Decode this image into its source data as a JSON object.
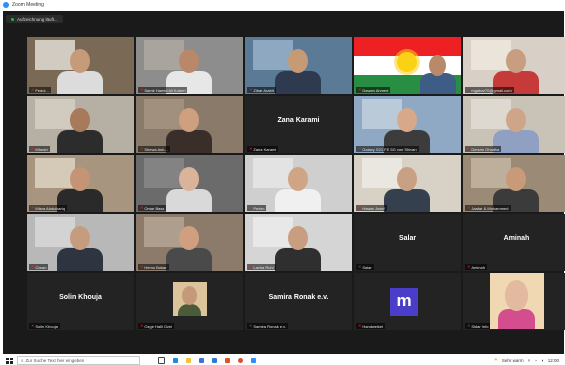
{
  "window": {
    "title": "Zoom Meeting"
  },
  "recording": {
    "label": "Aufzeichnung läuft..."
  },
  "tiles": [
    {
      "label": "Fedoi...",
      "muted": true,
      "kind": "video",
      "bg": "#7a6a55",
      "skin": "#c59b7a",
      "shirt": "#dcdcdc",
      "room": "#e8e4dc"
    },
    {
      "label": "Samir Hamid Ali Koberi",
      "muted": true,
      "kind": "video",
      "bg": "#8d8d8d",
      "skin": "#b9886a",
      "shirt": "#e7e7e7",
      "room": "#b0aba3"
    },
    {
      "label": "Zibar Arabit",
      "muted": true,
      "kind": "video",
      "bg": "#5b7a96",
      "skin": "#c79a76",
      "shirt": "#2d3a4f",
      "room": "#9bb4cc"
    },
    {
      "label": "Dawan Ahmed",
      "muted": true,
      "kind": "flag",
      "skin": "#b98a6a",
      "shirt": "#3d5d86"
    },
    {
      "label": "mgahar70@gmail.com",
      "muted": true,
      "kind": "video",
      "bg": "#d8d0c6",
      "skin": "#c99e80",
      "shirt": "#c63a3a",
      "room": "#efe9e0"
    },
    {
      "label": "Mhedd",
      "muted": true,
      "kind": "video",
      "bg": "#b6b0a4",
      "skin": "#a87a5c",
      "shirt": "#2c2c2c",
      "room": "#d8d2c6"
    },
    {
      "label": "Shewa Ash...",
      "muted": true,
      "kind": "video",
      "bg": "#8a7a6a",
      "skin": "#cfa080",
      "shirt": "#3a2e2a",
      "room": "#a89684"
    },
    {
      "label": "Zana Karami",
      "muted": true,
      "kind": "name",
      "name": "Zana Karami"
    },
    {
      "label": "Galaxy S21 FE 5G von Shivan",
      "muted": true,
      "kind": "video",
      "bg": "#8fa9c4",
      "skin": "#d7a98a",
      "shirt": "#3c3c3c",
      "room": "#c4d2de"
    },
    {
      "label": "Dersim Ghadha",
      "muted": true,
      "kind": "video",
      "speaking": true,
      "bg": "#c9c3b7",
      "skin": "#cfa58a",
      "shirt": "#8fa0c3",
      "room": "#e4dfd6"
    },
    {
      "label": "Misra Abdulkariq",
      "muted": true,
      "kind": "video",
      "bg": "#a89580",
      "skin": "#c49474",
      "shirt": "#2a2a2a",
      "room": "#e0d6c6"
    },
    {
      "label": "Omar Bass",
      "muted": true,
      "kind": "video",
      "bg": "#6b6b6b",
      "skin": "#d9b39a",
      "shirt": "#d9d9d9",
      "room": "#8a8a8a"
    },
    {
      "label": "Pezim",
      "muted": true,
      "kind": "video",
      "bg": "#cfcfcf",
      "skin": "#d0a585",
      "shirt": "#f0f0f0",
      "room": "#e7e7e7"
    },
    {
      "label": "Hawar Josef",
      "muted": true,
      "kind": "video",
      "bg": "#d7d1c6",
      "skin": "#c8a084",
      "shirt": "#35404f",
      "room": "#efece6"
    },
    {
      "label": "Jaafar & Mohammed",
      "muted": true,
      "kind": "video",
      "bg": "#9b8a76",
      "skin": "#c89a78",
      "shirt": "#3b3b3b",
      "room": "#c6b8a6"
    },
    {
      "label": "Ciwan",
      "muted": true,
      "kind": "video",
      "bg": "#b8b8b8",
      "skin": "#c69c7e",
      "shirt": "#2e3540",
      "room": "#d9d9d9"
    },
    {
      "label": "Hemo Bokar",
      "muted": true,
      "kind": "video",
      "bg": "#8c7b6a",
      "skin": "#cf9f7f",
      "shirt": "#4a4a4a",
      "room": "#b7a796"
    },
    {
      "label": "Lacha Ruhi",
      "muted": true,
      "kind": "video",
      "bg": "#d5d5d5",
      "skin": "#c99e80",
      "shirt": "#2f2f2f",
      "room": "#ececec"
    },
    {
      "label": "Salar",
      "muted": true,
      "kind": "name",
      "name": "Salar"
    },
    {
      "label": "Aminah",
      "muted": true,
      "kind": "name",
      "name": "Aminah"
    },
    {
      "label": "Solin Khouja",
      "muted": true,
      "kind": "name",
      "name": "Solin Khouja"
    },
    {
      "label": "Ozge Halil Ozel",
      "muted": true,
      "kind": "photo",
      "bg": "#232323",
      "skin": "#c59a7a",
      "shirt": "#4a5a3a",
      "room": "#dcc49a"
    },
    {
      "label": "Samira Ronak e.v.",
      "muted": true,
      "kind": "name",
      "name": "Samira Ronak e.v."
    },
    {
      "label": "Handweikel",
      "muted": true,
      "kind": "avatar",
      "letter": "m"
    },
    {
      "label": "Sidar Info",
      "muted": true,
      "kind": "photo-large",
      "bg": "#232323",
      "skin": "#e3b9a0",
      "shirt": "#d44d8f",
      "room": "#f0d8b2"
    }
  ],
  "taskbar": {
    "search_placeholder": "Zur Suche Text hier eingeben",
    "tray_text": "Sehr warm",
    "time": "12:00"
  },
  "colors": {
    "meeting_bg": "#1a1a1a",
    "tile_bg": "#232323",
    "speaking_outline": "#c8d23a",
    "muted_icon": "#e02828"
  }
}
